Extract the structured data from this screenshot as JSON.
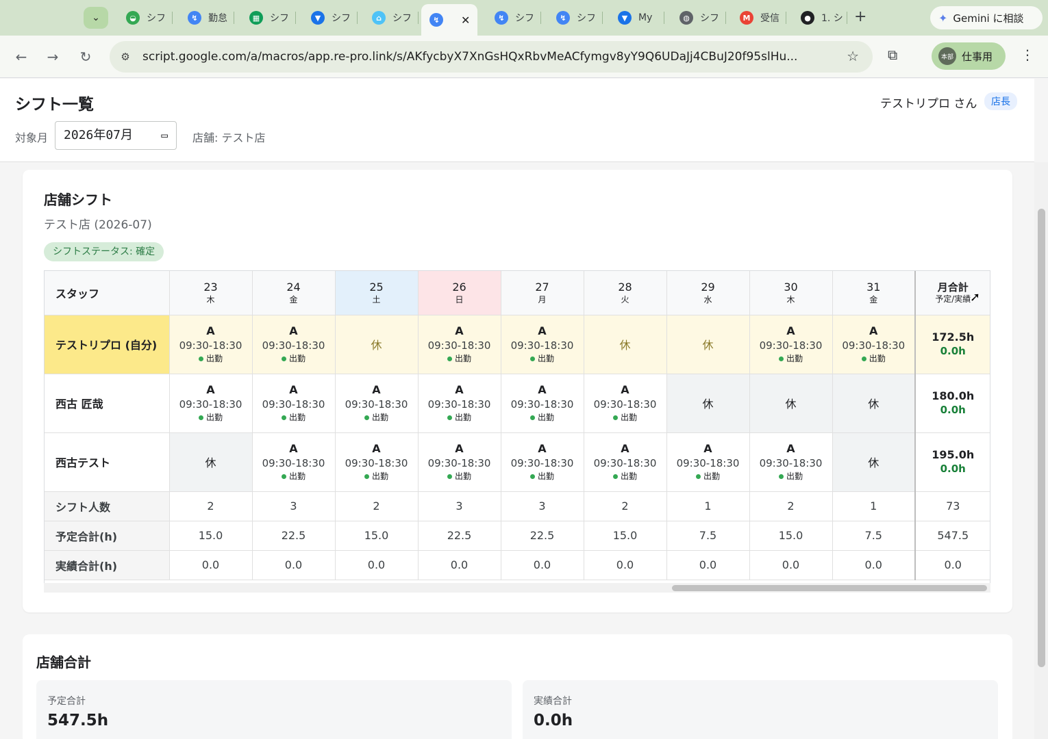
{
  "browser": {
    "tabs": [
      {
        "label": "シフ",
        "icon": "google-drive-icon",
        "color": "#34a853"
      },
      {
        "label": "勤怠",
        "icon": "apps-script-icon",
        "color": "#4285f4"
      },
      {
        "label": "シフ",
        "icon": "sheets-icon",
        "color": "#0f9d58"
      },
      {
        "label": "シフ",
        "icon": "v-icon",
        "color": "#1a73e8"
      },
      {
        "label": "シフ",
        "icon": "cart-icon",
        "color": "#4fc3f7"
      },
      {
        "label": "",
        "icon": "apps-script-icon",
        "color": "#4285f4",
        "close": "✕"
      },
      {
        "label": "シフ",
        "icon": "apps-script-icon",
        "color": "#4285f4"
      },
      {
        "label": "シフ",
        "icon": "apps-script-icon",
        "color": "#4285f4"
      },
      {
        "label": "My",
        "icon": "v-icon",
        "color": "#1a73e8"
      },
      {
        "label": "シフ",
        "icon": "globe-icon",
        "color": "#5f6368"
      },
      {
        "label": "受信",
        "icon": "gmail-icon",
        "color": "#ea4335"
      },
      {
        "label": "1. シ",
        "icon": "github-icon",
        "color": "#202124"
      }
    ],
    "new_tab": "+",
    "gemini_label": "Gemini に相談",
    "url": "script.google.com/a/macros/app.re-pro.link/s/AKfycbyX7XnGsHQxRbvMeACfymgv8yY9Q6UDaJj4CBuJ20f95slHu...",
    "profile_label": "仕事用",
    "profile_avatar": "本部"
  },
  "header": {
    "title": "シフト一覧",
    "user": "テストリプロ さん",
    "role": "店長",
    "month_label": "対象月",
    "month_value": "2026年07月",
    "store_label": "店舗: テスト店"
  },
  "shift_card": {
    "title": "店舗シフト",
    "subtitle": "テスト店 (2026-07)",
    "status": "シフトステータス: 確定",
    "staff_header": "スタッフ",
    "total_header": "月合計",
    "total_sub": "予定/実績",
    "days": [
      {
        "num": "23",
        "wd": "木",
        "type": "normal"
      },
      {
        "num": "24",
        "wd": "金",
        "type": "normal"
      },
      {
        "num": "25",
        "wd": "土",
        "type": "sat"
      },
      {
        "num": "26",
        "wd": "日",
        "type": "sun"
      },
      {
        "num": "27",
        "wd": "月",
        "type": "normal"
      },
      {
        "num": "28",
        "wd": "火",
        "type": "normal"
      },
      {
        "num": "29",
        "wd": "水",
        "type": "normal"
      },
      {
        "num": "30",
        "wd": "木",
        "type": "normal"
      },
      {
        "num": "31",
        "wd": "金",
        "type": "normal"
      }
    ],
    "shift_code": "A",
    "shift_time": "09:30-18:30",
    "attend_label": "出勤",
    "off_label": "休",
    "staff": [
      {
        "name": "テストリプロ (自分)",
        "self": true,
        "cells": [
          "A",
          "A",
          "休",
          "A",
          "A",
          "休",
          "休",
          "A",
          "A"
        ],
        "planned": "172.5h",
        "actual": "0.0h"
      },
      {
        "name": "西古 匠哉",
        "self": false,
        "cells": [
          "A",
          "A",
          "A",
          "A",
          "A",
          "A",
          "休",
          "休",
          "休"
        ],
        "planned": "180.0h",
        "actual": "0.0h"
      },
      {
        "name": "西古テスト",
        "self": false,
        "cells": [
          "休",
          "A",
          "A",
          "A",
          "A",
          "A",
          "A",
          "A",
          "休"
        ],
        "planned": "195.0h",
        "actual": "0.0h"
      }
    ],
    "summary": [
      {
        "label": "シフト人数",
        "values": [
          "2",
          "3",
          "2",
          "3",
          "3",
          "2",
          "1",
          "2",
          "1"
        ],
        "total": "73"
      },
      {
        "label": "予定合計(h)",
        "values": [
          "15.0",
          "22.5",
          "15.0",
          "22.5",
          "22.5",
          "15.0",
          "7.5",
          "15.0",
          "7.5"
        ],
        "total": "547.5"
      },
      {
        "label": "実績合計(h)",
        "values": [
          "0.0",
          "0.0",
          "0.0",
          "0.0",
          "0.0",
          "0.0",
          "0.0",
          "0.0",
          "0.0"
        ],
        "total": "0.0"
      }
    ]
  },
  "totals_card": {
    "title": "店舗合計",
    "planned_label": "予定合計",
    "planned_value": "547.5h",
    "actual_label": "実績合計",
    "actual_value": "0.0h"
  }
}
